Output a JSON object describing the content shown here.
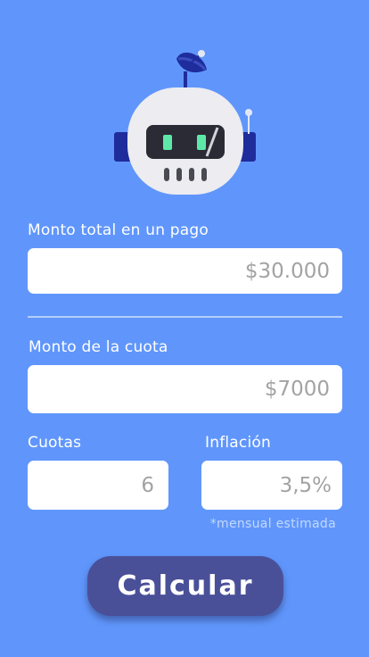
{
  "fields": {
    "monto_total": {
      "label": "Monto total en un pago",
      "placeholder": "$30.000"
    },
    "monto_cuota": {
      "label": "Monto de la cuota",
      "placeholder": "$7000"
    },
    "cuotas": {
      "label": "Cuotas",
      "placeholder": "6"
    },
    "inflacion": {
      "label": "Inflación",
      "placeholder": "3,5%",
      "note": "*mensual estimada"
    }
  },
  "actions": {
    "calcular_label": "Calcular"
  },
  "colors": {
    "background": "#6096fb",
    "button": "#4a5098",
    "robot_body": "#ececf1",
    "robot_dark": "#1f2c9c",
    "robot_eye": "#5ee8a8"
  }
}
